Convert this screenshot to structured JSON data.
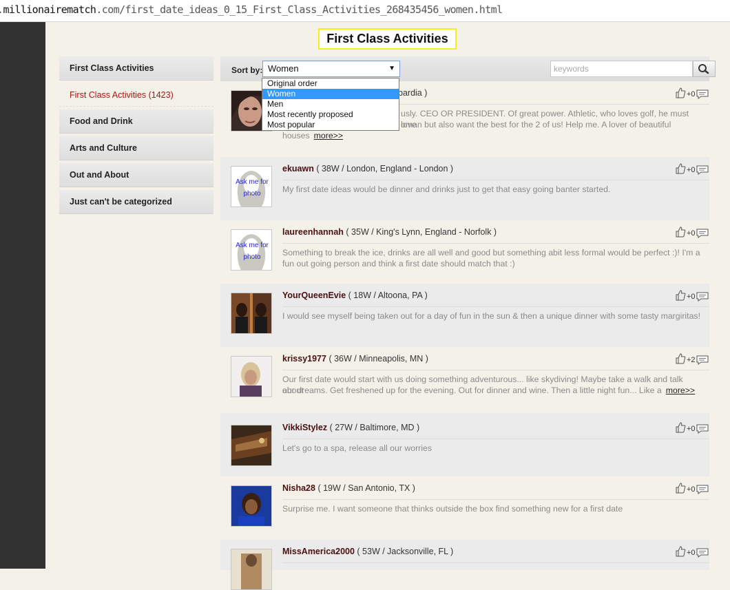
{
  "browser": {
    "url_prefix": ".",
    "url_host": "millionairematch",
    "url_rest": ".com/first_date_ideas_0_15_First_Class_Activities_268435456_women.html"
  },
  "page": {
    "title": "First Class Activities"
  },
  "sidebar": {
    "items": [
      {
        "label": "First Class Activities"
      },
      {
        "label": "First Class Activities (1423)"
      },
      {
        "label": "Food and Drink"
      },
      {
        "label": "Arts and Culture"
      },
      {
        "label": "Out and About"
      },
      {
        "label": "Just can't be categorized"
      }
    ]
  },
  "sort": {
    "label": "Sort by:",
    "selected": "Women",
    "options": [
      "Original order",
      "Women",
      "Men",
      "Most recently proposed",
      "Most popular"
    ]
  },
  "search": {
    "placeholder": "keywords"
  },
  "posts": [
    {
      "meta_partial": "bardia )",
      "votes": "+0",
      "text_l1": "usly. CEO OR PRESIDENT. Of great power. Athletic, who loves golf, he must love",
      "text_l2": "oman but also want the best for the 2 of us! Help me. A lover of beautiful",
      "text_l3": "houses",
      "more": "more>>"
    },
    {
      "username": "ekuawn",
      "meta": "( 38W / London, England - London )",
      "votes": "+0",
      "ask": "Ask me for photo",
      "text": "My first date ideas would be dinner and drinks just to get that easy going banter started."
    },
    {
      "username": "laureenhannah",
      "meta": "( 35W / King's Lynn, England - Norfolk )",
      "votes": "+0",
      "ask": "Ask me for photo",
      "text_l1": "Something to break the ice, drinks are all well and good but something abit less formal would be perfect :)! I'm a",
      "text_l2": "fun out going person and think a first date should match that :)"
    },
    {
      "username": "YourQueenEvie",
      "meta": "( 18W / Altoona, PA )",
      "votes": "+0",
      "text": "I would see myself being taken out for a day of fun in the sun & then a unique dinner with some tasty margiritas!"
    },
    {
      "username": "krissy1977",
      "meta": "( 36W / Minneapolis, MN )",
      "votes": "+2",
      "text_l1": "Our first date would start with us doing something adventurous... like skydiving! Maybe take a walk and talk about",
      "text_l2": "our dreams. Get freshened up for the evening. Out for dinner and wine. Then a little night fun... Like a",
      "more": "more>>"
    },
    {
      "username": "VikkiStylez",
      "meta": "( 27W / Baltimore, MD )",
      "votes": "+0",
      "text": "Let's go to a spa, release all our worries"
    },
    {
      "username": "Nisha28",
      "meta": "( 19W / San Antonio, TX )",
      "votes": "+0",
      "text": "Surprise me. I want someone that thinks outside the box find something new for a first date"
    },
    {
      "username": "MissAmerica2000",
      "meta": "( 53W / Jacksonville, FL )",
      "votes": "+0"
    }
  ],
  "icons": {
    "like": "thumbs-up-icon",
    "comment": "comment-icon",
    "search": "magnifier-icon",
    "dropdown": "chevron-down-icon"
  },
  "colors": {
    "username": "#4a1010",
    "selected_option": "#3399ff",
    "title_border": "#f5ef1a",
    "sidebar_active": "#b41010"
  }
}
